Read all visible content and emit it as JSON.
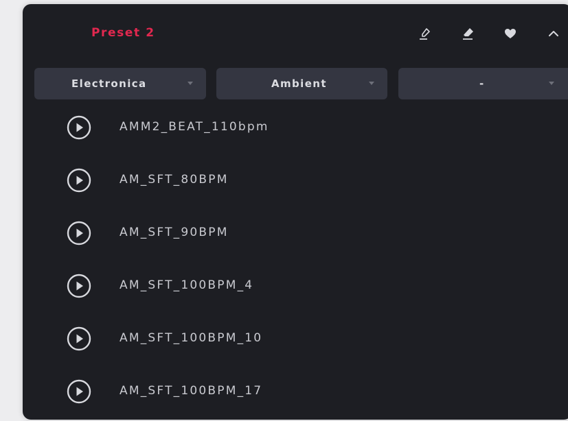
{
  "header": {
    "preset_title": "Preset 2",
    "icons": [
      "edit-icon",
      "eraser-icon",
      "heart-icon",
      "chevron-up-icon"
    ]
  },
  "filters": [
    {
      "label": "Electronica"
    },
    {
      "label": "Ambient"
    },
    {
      "label": "-"
    }
  ],
  "tracks": [
    {
      "name": "AMM2_BEAT_110bpm"
    },
    {
      "name": "AM_SFT_80BPM"
    },
    {
      "name": "AM_SFT_90BPM"
    },
    {
      "name": "AM_SFT_100BPM_4"
    },
    {
      "name": "AM_SFT_100BPM_10"
    },
    {
      "name": "AM_SFT_100BPM_17"
    }
  ],
  "colors": {
    "accent": "#e2284f",
    "panel_bg": "#1d1e23",
    "dropdown_bg": "#343641",
    "text": "#c9cad0"
  }
}
